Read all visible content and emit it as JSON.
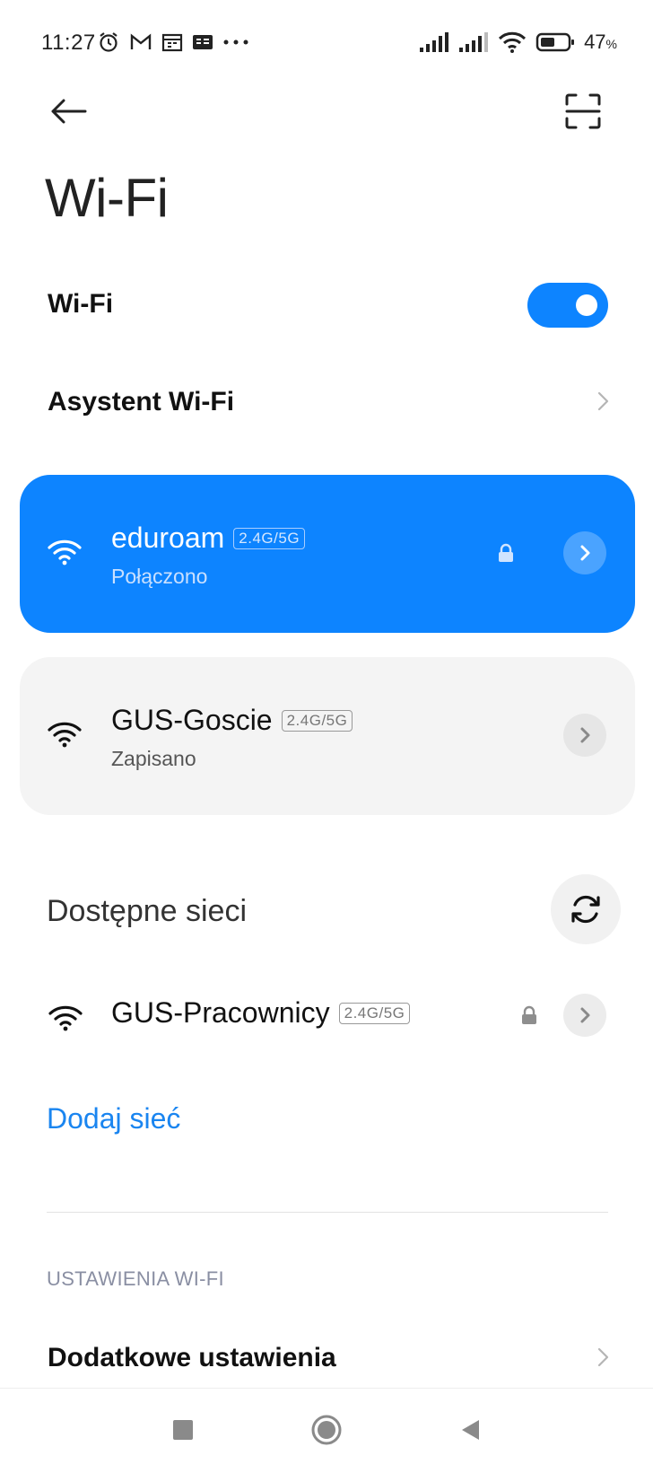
{
  "status_bar": {
    "time": "11:27",
    "left_icons": [
      "alarm-icon",
      "gmail-icon",
      "calendar-icon",
      "news-icon",
      "more-dots-icon"
    ],
    "right_icons": [
      "signal-icon",
      "signal-icon-2",
      "wifi-status-icon",
      "battery-icon"
    ],
    "battery_value": "47",
    "battery_unit": "%"
  },
  "header": {
    "back_icon": "arrow-left-icon",
    "scan_icon": "qr-scan-icon",
    "title": "Wi-Fi"
  },
  "wifi_toggle": {
    "label": "Wi-Fi",
    "state": "on"
  },
  "assistant": {
    "label": "Asystent Wi-Fi"
  },
  "connected_network": {
    "name": "eduroam",
    "band": "2.4G/5G",
    "status": "Połączono",
    "secured": true
  },
  "saved_network": {
    "name": "GUS-Goscie",
    "band": "2.4G/5G",
    "status": "Zapisano",
    "secured": false
  },
  "available": {
    "heading": "Dostępne sieci",
    "networks": [
      {
        "name": "GUS-Pracownicy",
        "band": "2.4G/5G",
        "secured": true
      }
    ]
  },
  "add_network_label": "Dodaj sieć",
  "settings": {
    "caption": "USTAWIENIA WI-FI",
    "items": [
      {
        "label": "Dodatkowe ustawienia"
      }
    ]
  },
  "colors": {
    "accent": "#0d84ff",
    "link": "#1a85f0",
    "card_gray": "#f4f4f4"
  }
}
